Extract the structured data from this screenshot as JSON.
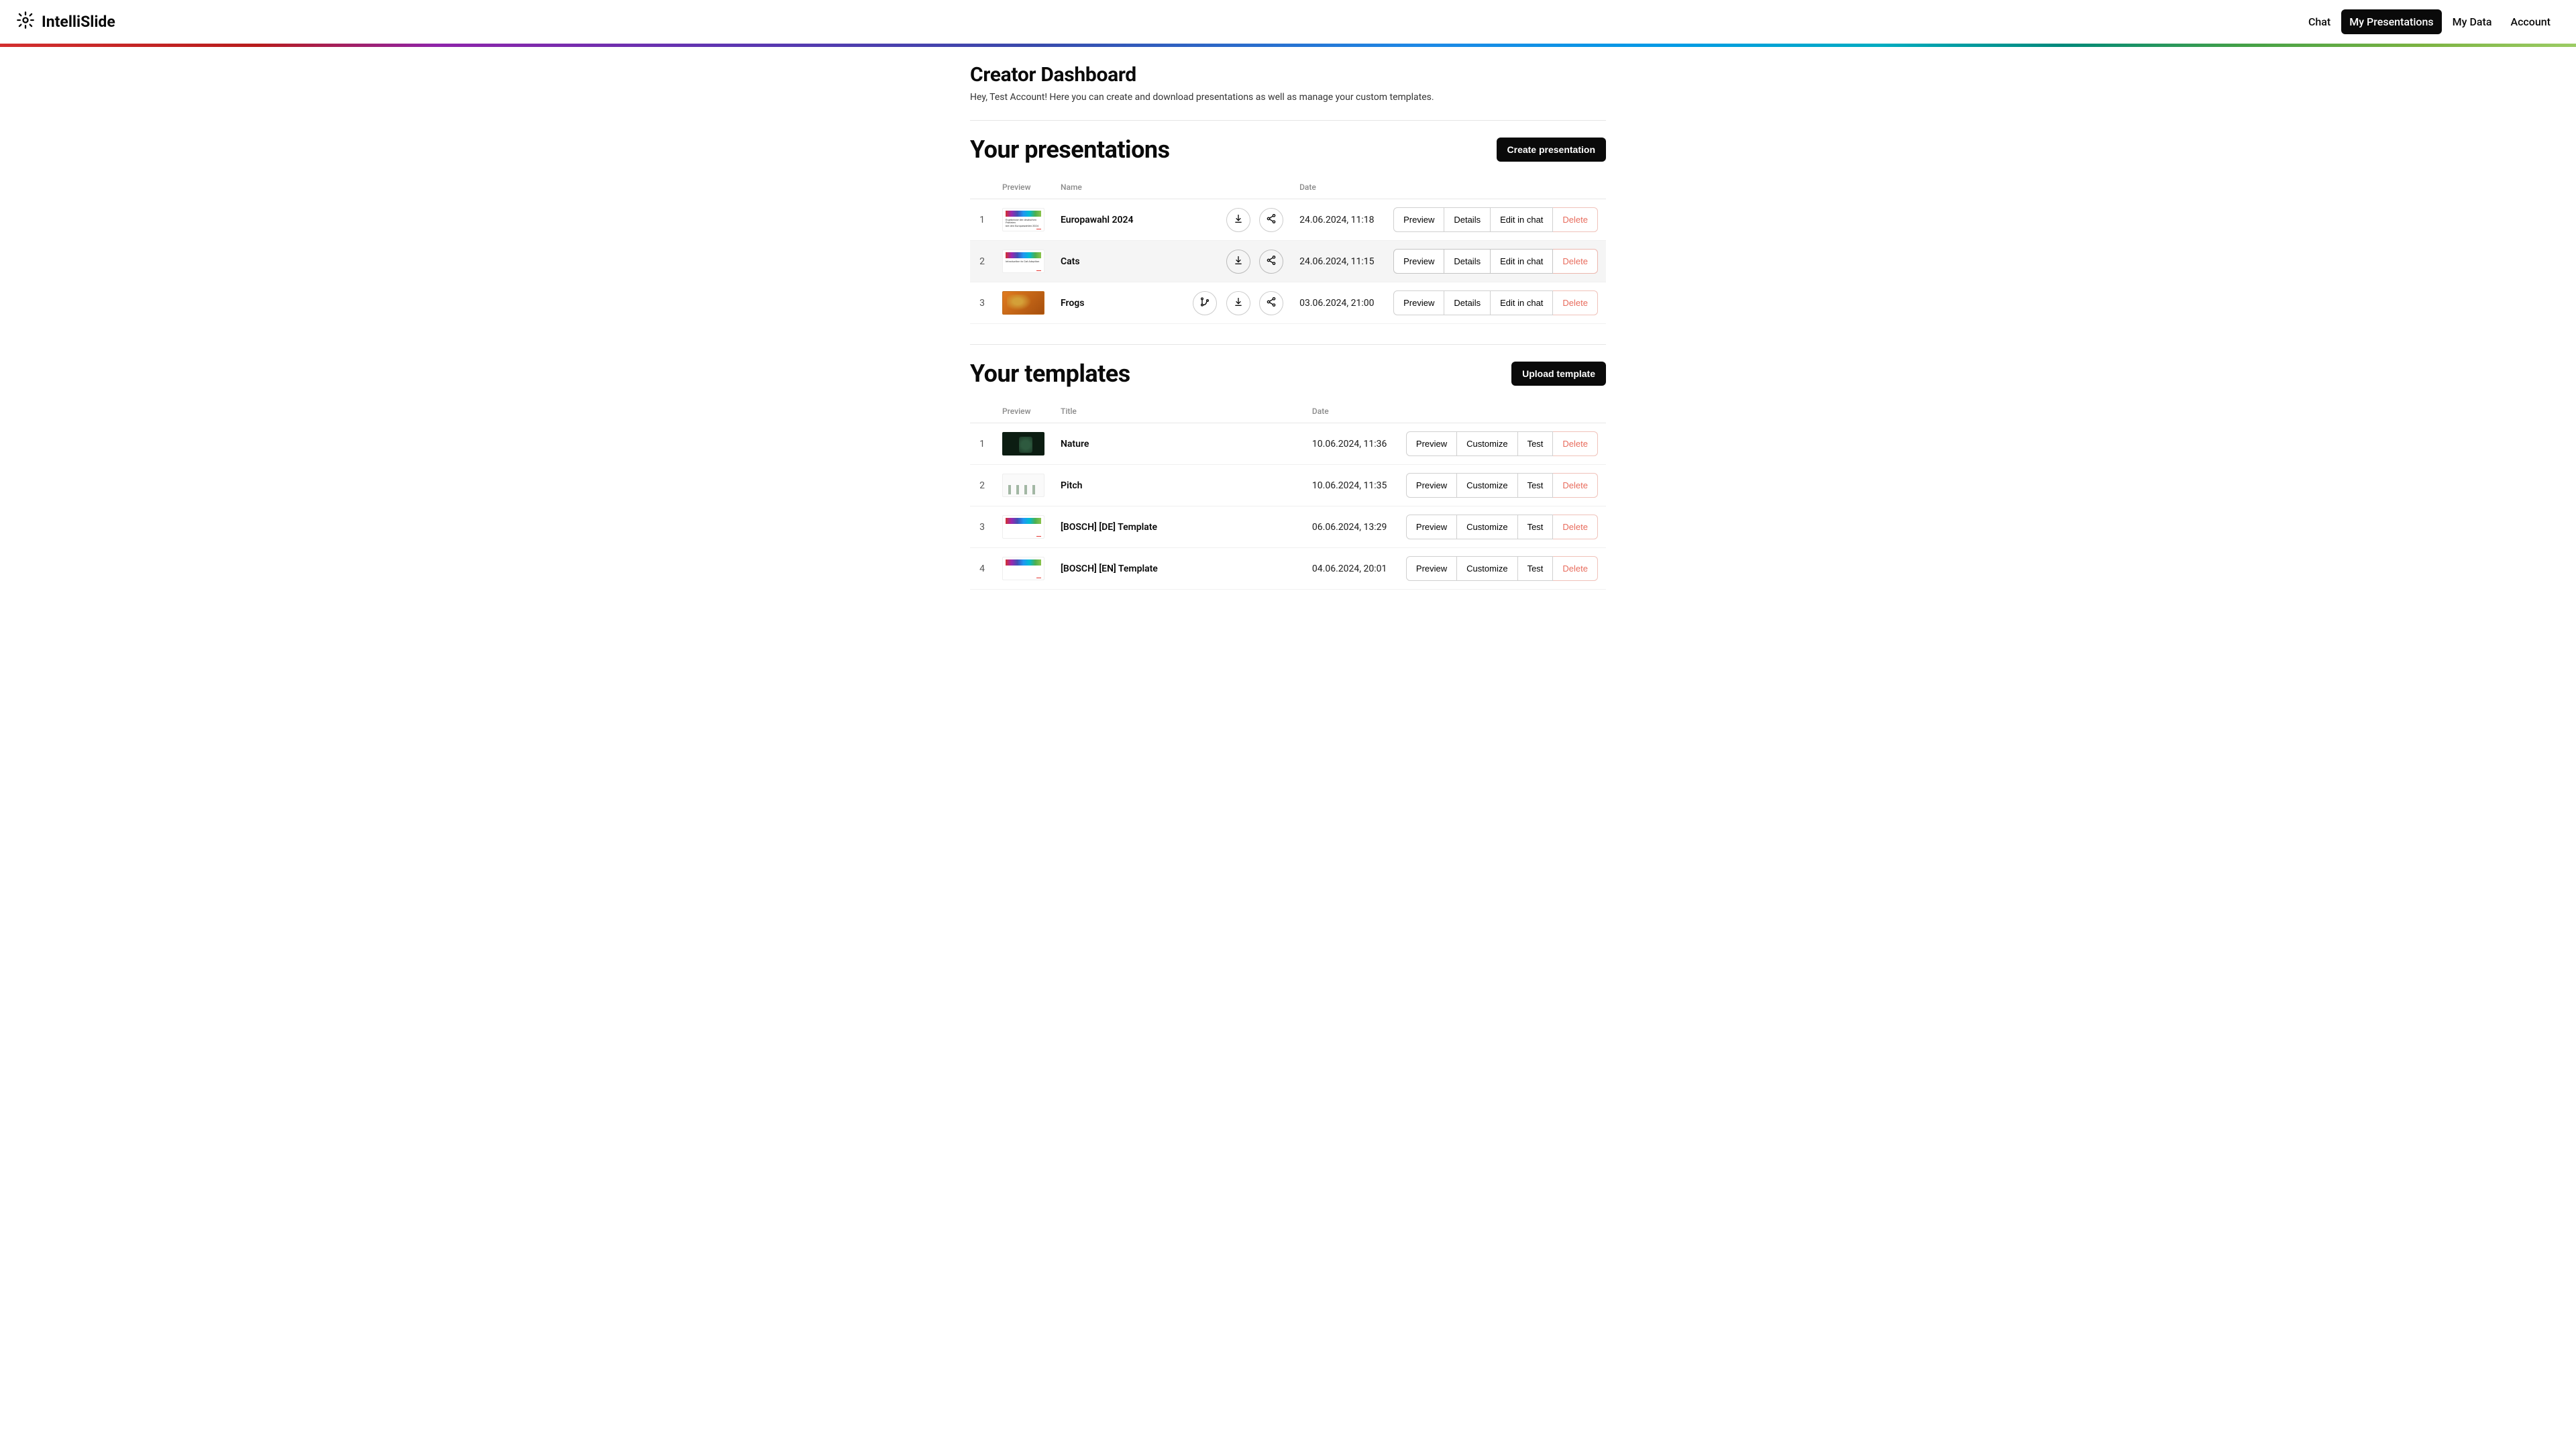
{
  "brand": "IntelliSlide",
  "nav": {
    "chat": "Chat",
    "my_presentations": "My Presentations",
    "my_data": "My Data",
    "account": "Account"
  },
  "header": {
    "title": "Creator Dashboard",
    "subtitle": "Hey, Test Account! Here you can create and download presentations as well as manage your custom templates."
  },
  "presentations": {
    "title": "Your presentations",
    "create_label": "Create presentation",
    "cols": {
      "preview": "Preview",
      "name": "Name",
      "date": "Date"
    },
    "actions": {
      "preview": "Preview",
      "details": "Details",
      "edit": "Edit in chat",
      "delete": "Delete"
    },
    "rows": [
      {
        "num": "1",
        "name": "Europawahl 2024",
        "date": "24.06.2024, 11:18"
      },
      {
        "num": "2",
        "name": "Cats",
        "date": "24.06.2024, 11:15"
      },
      {
        "num": "3",
        "name": "Frogs",
        "date": "03.06.2024, 21:00"
      }
    ]
  },
  "templates": {
    "title": "Your templates",
    "upload_label": "Upload template",
    "cols": {
      "preview": "Preview",
      "title": "Title",
      "date": "Date"
    },
    "actions": {
      "preview": "Preview",
      "customize": "Customize",
      "test": "Test",
      "delete": "Delete"
    },
    "rows": [
      {
        "num": "1",
        "title": "Nature",
        "date": "10.06.2024, 11:36"
      },
      {
        "num": "2",
        "title": "Pitch",
        "date": "10.06.2024, 11:35"
      },
      {
        "num": "3",
        "title": "[BOSCH] [DE] Template",
        "date": "06.06.2024, 13:29"
      },
      {
        "num": "4",
        "title": "[BOSCH] [EN] Template",
        "date": "04.06.2024, 20:01"
      }
    ]
  }
}
